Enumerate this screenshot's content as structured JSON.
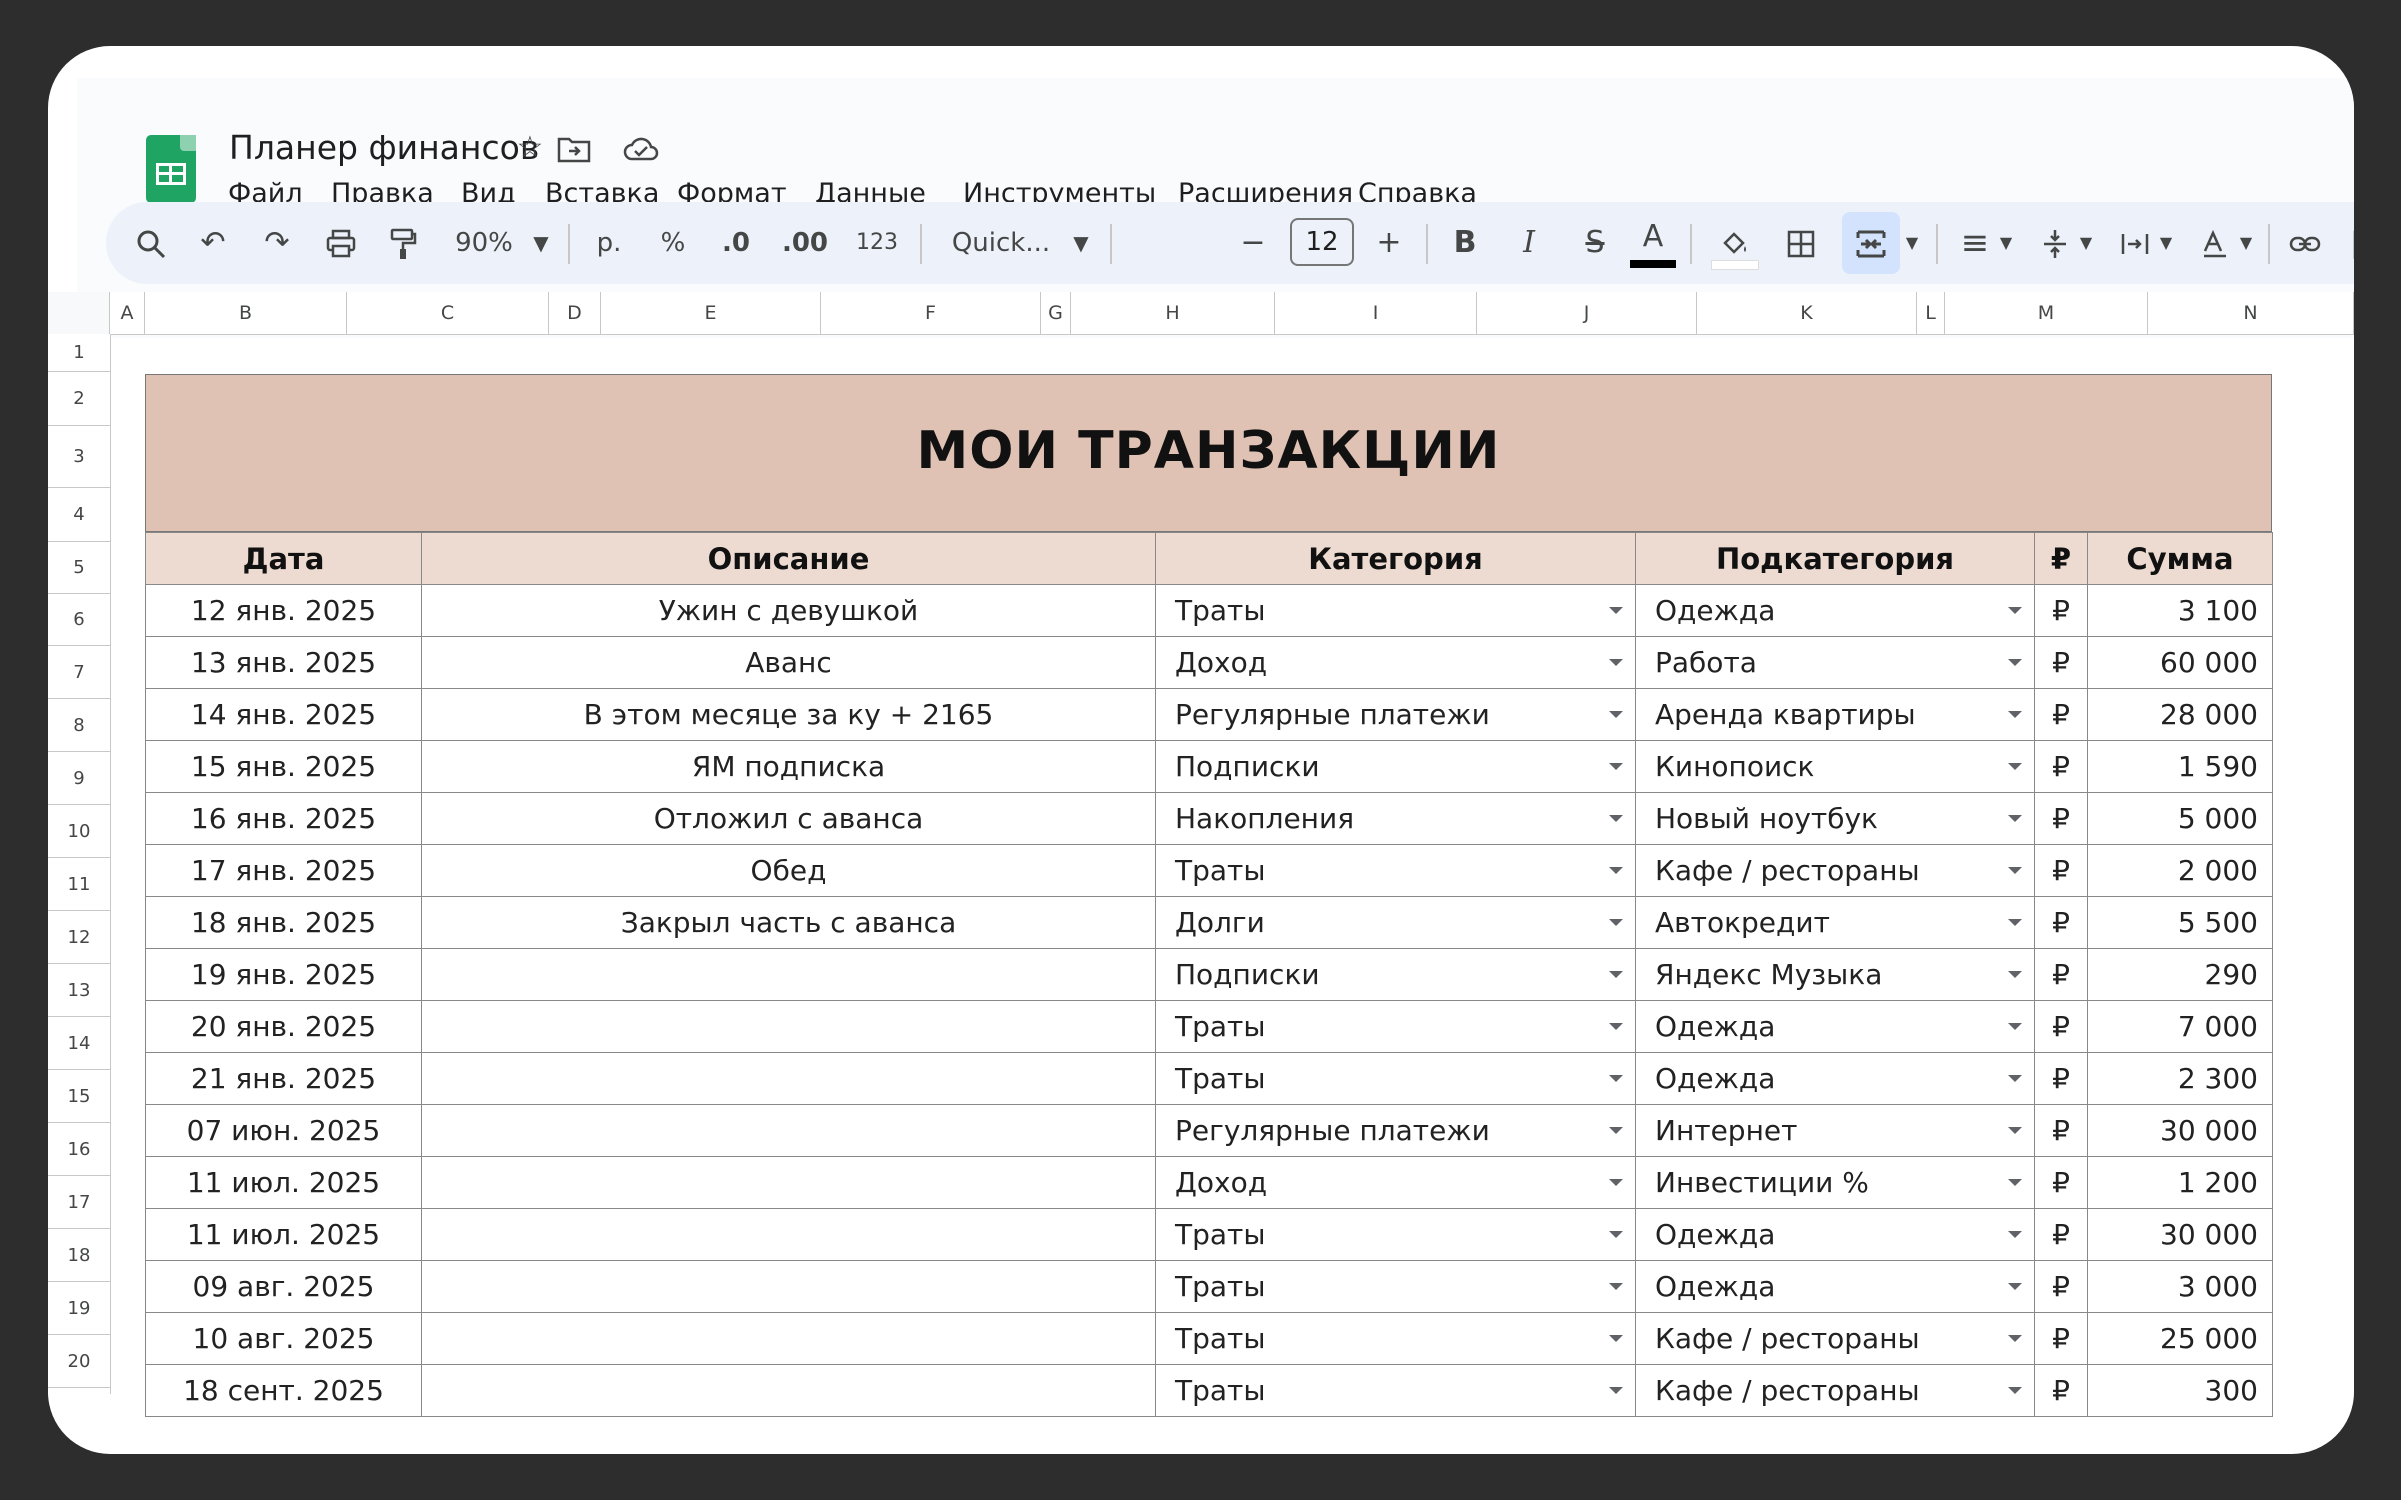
{
  "app": {
    "title": "Планер финансов",
    "icons": [
      "star-icon",
      "move-to-folder-icon",
      "cloud-saved-icon"
    ]
  },
  "menu": [
    "Файл",
    "Правка",
    "Вид",
    "Вставка",
    "Формат",
    "Данные",
    "Инструменты",
    "Расширения",
    "Справка"
  ],
  "toolbar": {
    "zoom": "90%",
    "currency": "р.",
    "percent": "%",
    "dec_decrease": ".0",
    "dec_increase": ".00",
    "number_format": "123",
    "font": "Quick...",
    "minus": "−",
    "font_size": "12",
    "plus": "+",
    "bold": "B",
    "italic": "I",
    "text_color_label": "A",
    "text_color": "#000000",
    "accent_active": "#d3e3fd"
  },
  "columns": [
    "A",
    "B",
    "C",
    "D",
    "E",
    "F",
    "G",
    "H",
    "I",
    "J",
    "K",
    "L",
    "M",
    "N"
  ],
  "rows": [
    "1",
    "2",
    "3",
    "4",
    "5",
    "6",
    "7",
    "8",
    "9",
    "10",
    "11",
    "12",
    "13",
    "14",
    "15",
    "16",
    "17",
    "18",
    "19",
    "20"
  ],
  "sheet": {
    "title": "МОИ ТРАНЗАКЦИИ",
    "title_bg": "#dfc2b4",
    "header_bg": "#eddbd2",
    "headers": {
      "date": "Дата",
      "description": "Описание",
      "category": "Категория",
      "subcategory": "Подкатегория",
      "currency": "₽",
      "amount": "Сумма"
    },
    "transactions": [
      {
        "date": "12 янв. 2025",
        "description": "Ужин с девушкой",
        "category": "Траты",
        "subcategory": "Одежда",
        "currency": "₽",
        "amount": "3 100"
      },
      {
        "date": "13 янв. 2025",
        "description": "Аванс",
        "category": "Доход",
        "subcategory": "Работа",
        "currency": "₽",
        "amount": "60 000"
      },
      {
        "date": "14 янв. 2025",
        "description": "В этом месяце за ку + 2165",
        "category": "Регулярные платежи",
        "subcategory": "Аренда квартиры",
        "currency": "₽",
        "amount": "28 000"
      },
      {
        "date": "15 янв. 2025",
        "description": "ЯМ подписка",
        "category": "Подписки",
        "subcategory": "Кинопоиск",
        "currency": "₽",
        "amount": "1 590"
      },
      {
        "date": "16 янв. 2025",
        "description": "Отложил с аванса",
        "category": "Накопления",
        "subcategory": "Новый ноутбук",
        "currency": "₽",
        "amount": "5 000"
      },
      {
        "date": "17 янв. 2025",
        "description": "Обед",
        "category": "Траты",
        "subcategory": "Кафе / рестораны",
        "currency": "₽",
        "amount": "2 000"
      },
      {
        "date": "18 янв. 2025",
        "description": "Закрыл часть с аванса",
        "category": "Долги",
        "subcategory": "Автокредит",
        "currency": "₽",
        "amount": "5 500"
      },
      {
        "date": "19 янв. 2025",
        "description": "",
        "category": "Подписки",
        "subcategory": "Яндекс Музыка",
        "currency": "₽",
        "amount": "290"
      },
      {
        "date": "20 янв. 2025",
        "description": "",
        "category": "Траты",
        "subcategory": "Одежда",
        "currency": "₽",
        "amount": "7 000"
      },
      {
        "date": "21 янв. 2025",
        "description": "",
        "category": "Траты",
        "subcategory": "Одежда",
        "currency": "₽",
        "amount": "2 300"
      },
      {
        "date": "07 июн. 2025",
        "description": "",
        "category": "Регулярные платежи",
        "subcategory": "Интернет",
        "currency": "₽",
        "amount": "30 000"
      },
      {
        "date": "11 июл. 2025",
        "description": "",
        "category": "Доход",
        "subcategory": "Инвестиции %",
        "currency": "₽",
        "amount": "1 200"
      },
      {
        "date": "11 июл. 2025",
        "description": "",
        "category": "Траты",
        "subcategory": "Одежда",
        "currency": "₽",
        "amount": "30 000"
      },
      {
        "date": "09 авг. 2025",
        "description": "",
        "category": "Траты",
        "subcategory": "Одежда",
        "currency": "₽",
        "amount": "3 000"
      },
      {
        "date": "10 авг. 2025",
        "description": "",
        "category": "Траты",
        "subcategory": "Кафе / рестораны",
        "currency": "₽",
        "amount": "25 000"
      },
      {
        "date": "18 сент. 2025",
        "description": "",
        "category": "Траты",
        "subcategory": "Кафе / рестораны",
        "currency": "₽",
        "amount": "300"
      }
    ]
  }
}
